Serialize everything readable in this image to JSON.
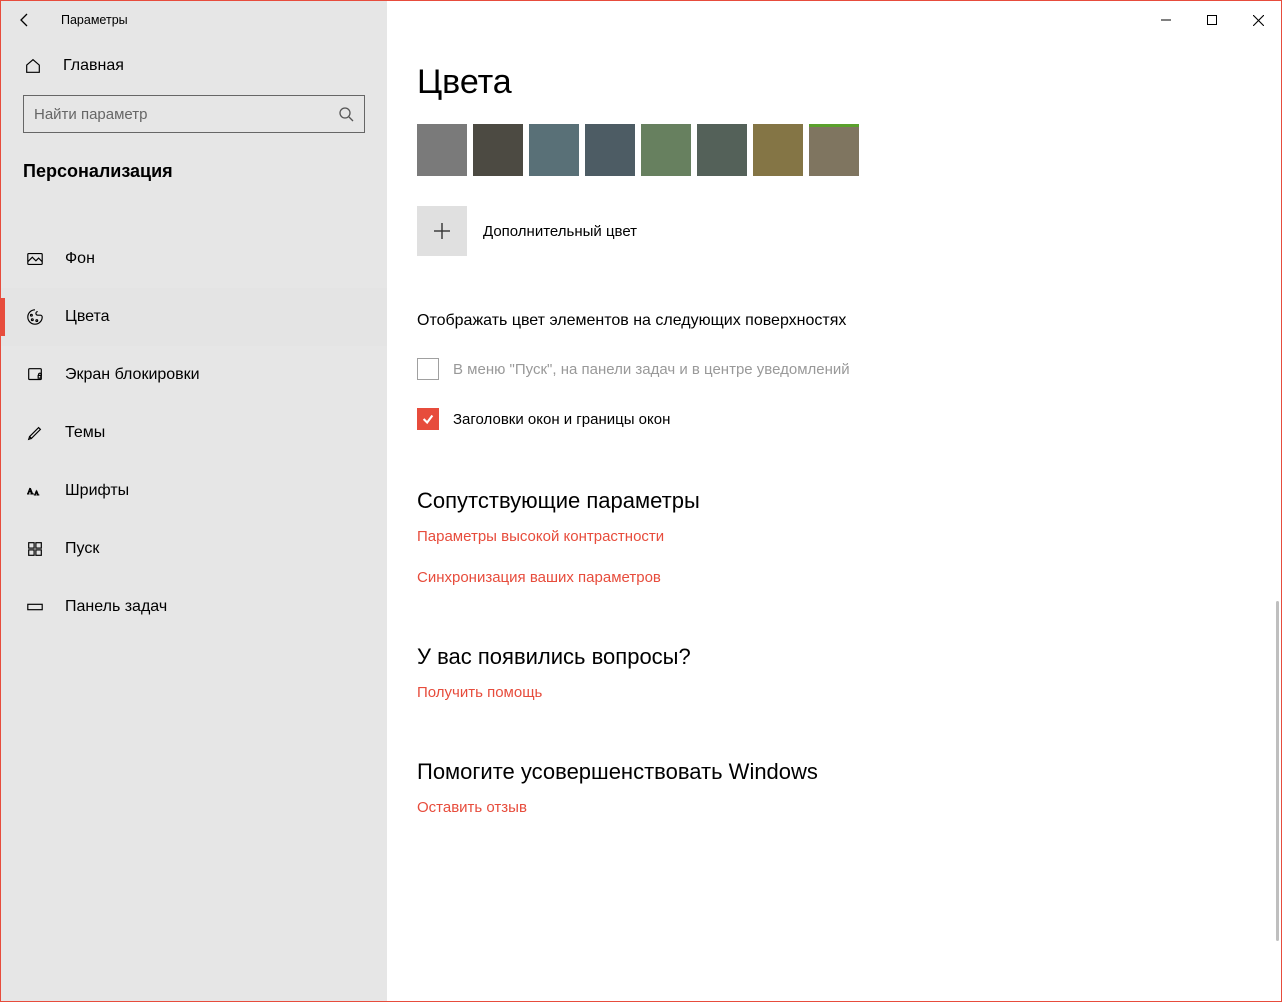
{
  "colors": {
    "accent": "#e74c3c",
    "link": "#e74c3c",
    "sidebar_bg": "#e6e6e6"
  },
  "window": {
    "title": "Параметры"
  },
  "sidebar": {
    "home_label": "Главная",
    "search_placeholder": "Найти параметр",
    "section": "Персонализация",
    "items": [
      {
        "label": "Фон",
        "icon": "picture-icon",
        "active": false
      },
      {
        "label": "Цвета",
        "icon": "palette-icon",
        "active": true
      },
      {
        "label": "Экран блокировки",
        "icon": "lockscreen-icon",
        "active": false
      },
      {
        "label": "Темы",
        "icon": "themes-icon",
        "active": false
      },
      {
        "label": "Шрифты",
        "icon": "fonts-icon",
        "active": false
      },
      {
        "label": "Пуск",
        "icon": "start-icon",
        "active": false
      },
      {
        "label": "Панель задач",
        "icon": "taskbar-icon",
        "active": false
      }
    ]
  },
  "main": {
    "page_title": "Цвета",
    "swatches": [
      "#7a7a7a",
      "#4c4a42",
      "#597077",
      "#4d5c64",
      "#67805f",
      "#546159",
      "#847545",
      "#7f7560"
    ],
    "swatch_accent_index": 7,
    "add_color_label": "Дополнительный цвет",
    "surfaces_heading": "Отображать цвет элементов на следующих поверхностях",
    "checkboxes": [
      {
        "label": "В меню \"Пуск\", на панели задач и в центре уведомлений",
        "checked": false,
        "disabled": true
      },
      {
        "label": "Заголовки окон и границы окон",
        "checked": true,
        "disabled": false
      }
    ],
    "related_heading": "Сопутствующие параметры",
    "related_links": [
      "Параметры высокой контрастности",
      "Синхронизация ваших параметров"
    ],
    "help_heading": "У вас появились вопросы?",
    "help_link": "Получить помощь",
    "feedback_heading": "Помогите усовершенствовать Windows",
    "feedback_link": "Оставить отзыв"
  }
}
